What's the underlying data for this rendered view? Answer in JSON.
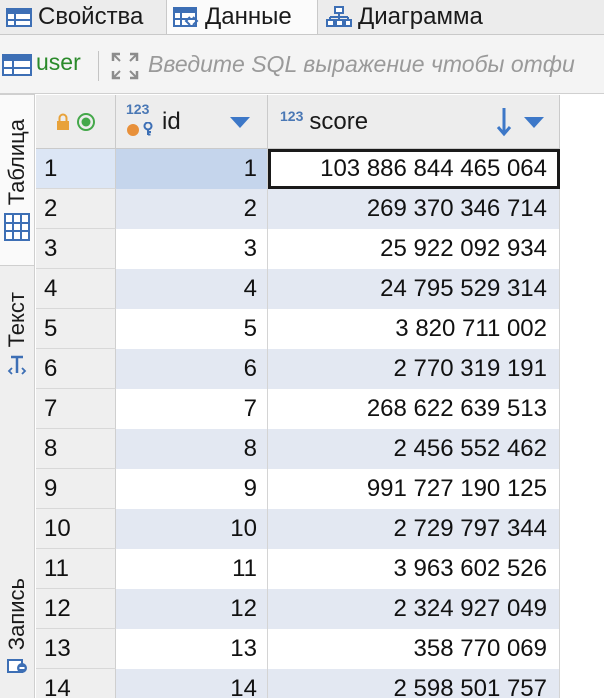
{
  "tabs": [
    {
      "label": "Свойства",
      "icon": "properties-icon",
      "active": false
    },
    {
      "label": "Данные",
      "icon": "data-grid-icon",
      "active": true
    },
    {
      "label": "Диаграмма",
      "icon": "diagram-icon",
      "active": false
    }
  ],
  "filter": {
    "entity_name": "user",
    "placeholder": "Введите SQL выражение чтобы отфи"
  },
  "side_tabs": {
    "table": "Таблица",
    "text": "Текст",
    "record": "Запись"
  },
  "columns": {
    "id": {
      "name": "id",
      "type": "123"
    },
    "score": {
      "name": "score",
      "type": "123",
      "sort": "descending"
    }
  },
  "rows": [
    {
      "n": "1",
      "id": "1",
      "score": "103 886 844 465 064"
    },
    {
      "n": "2",
      "id": "2",
      "score": "269 370 346 714"
    },
    {
      "n": "3",
      "id": "3",
      "score": "25 922 092 934"
    },
    {
      "n": "4",
      "id": "4",
      "score": "24 795 529 314"
    },
    {
      "n": "5",
      "id": "5",
      "score": "3 820 711 002"
    },
    {
      "n": "6",
      "id": "6",
      "score": "2 770 319 191"
    },
    {
      "n": "7",
      "id": "7",
      "score": "268 622 639 513"
    },
    {
      "n": "8",
      "id": "8",
      "score": "2 456 552 462"
    },
    {
      "n": "9",
      "id": "9",
      "score": "991 727 190 125"
    },
    {
      "n": "10",
      "id": "10",
      "score": "2 729 797 344"
    },
    {
      "n": "11",
      "id": "11",
      "score": "3 963 602 526"
    },
    {
      "n": "12",
      "id": "12",
      "score": "2 324 927 049"
    },
    {
      "n": "13",
      "id": "13",
      "score": "358 770 069"
    },
    {
      "n": "14",
      "id": "14",
      "score": "2 598 501 757"
    }
  ],
  "colors": {
    "accent": "#3d78c8",
    "stripe": "#e3e8f2",
    "entity": "#2a8a2a"
  }
}
